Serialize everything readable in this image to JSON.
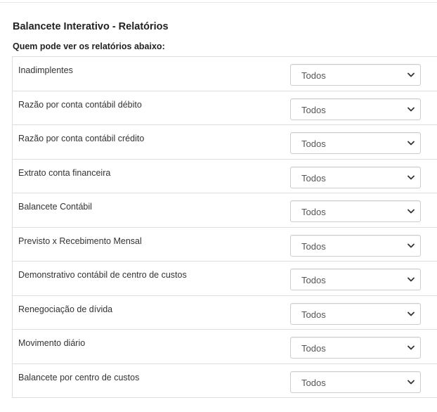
{
  "page": {
    "title": "Balancete Interativo - Relatórios",
    "subtitle": "Quem pode ver os relatórios abaixo:"
  },
  "reports": [
    {
      "label": "Inadimplentes",
      "visibility": "Todos"
    },
    {
      "label": "Razão por conta contábil débito",
      "visibility": "Todos"
    },
    {
      "label": "Razão por conta contábil crédito",
      "visibility": "Todos"
    },
    {
      "label": "Extrato conta financeira",
      "visibility": "Todos"
    },
    {
      "label": "Balancete Contábil",
      "visibility": "Todos"
    },
    {
      "label": "Previsto x Recebimento Mensal",
      "visibility": "Todos"
    },
    {
      "label": "Demonstrativo contábil de centro de custos",
      "visibility": "Todos"
    },
    {
      "label": "Renegociação de dívida",
      "visibility": "Todos"
    },
    {
      "label": "Movimento diário",
      "visibility": "Todos"
    },
    {
      "label": "Balancete por centro de custos",
      "visibility": "Todos"
    }
  ],
  "icons": {
    "dropdown": "chevron-down-icon"
  },
  "colors": {
    "border": "#dddddd",
    "text": "#333333",
    "select_text": "#555555"
  }
}
